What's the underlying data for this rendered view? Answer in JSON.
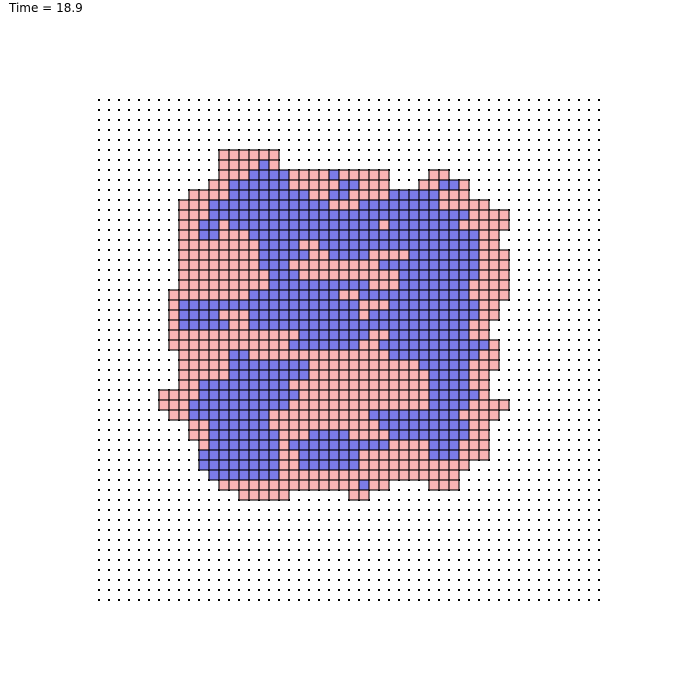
{
  "header": {
    "time_label": "Time = ",
    "time_value": "18.9"
  },
  "lattice": {
    "cols": 51,
    "rows": 51,
    "colors": {
      "blue": "#7b7be8",
      "pink": "#fab4b4",
      "grid_dot": "#000000",
      "cell_border": "#000000"
    },
    "row_runs": [
      [
        6,
        [
          [
            13,
            19,
            "P"
          ]
        ]
      ],
      [
        7,
        [
          [
            13,
            17,
            "P"
          ],
          [
            17,
            18,
            "B"
          ],
          [
            18,
            19,
            "P"
          ]
        ]
      ],
      [
        8,
        [
          [
            13,
            16,
            "P"
          ],
          [
            16,
            20,
            "B"
          ],
          [
            20,
            24,
            "P"
          ],
          [
            24,
            25,
            "B"
          ],
          [
            25,
            30,
            "P"
          ],
          [
            34,
            36,
            "P"
          ]
        ]
      ],
      [
        9,
        [
          [
            12,
            14,
            "P"
          ],
          [
            14,
            20,
            "B"
          ],
          [
            20,
            25,
            "P"
          ],
          [
            25,
            27,
            "B"
          ],
          [
            27,
            30,
            "P"
          ],
          [
            33,
            35,
            "P"
          ],
          [
            35,
            37,
            "B"
          ],
          [
            37,
            38,
            "P"
          ]
        ]
      ],
      [
        10,
        [
          [
            10,
            14,
            "P"
          ],
          [
            14,
            22,
            "B"
          ],
          [
            22,
            24,
            "P"
          ],
          [
            24,
            26,
            "B"
          ],
          [
            26,
            30,
            "P"
          ],
          [
            30,
            35,
            "B"
          ],
          [
            35,
            38,
            "P"
          ]
        ]
      ],
      [
        11,
        [
          [
            9,
            12,
            "P"
          ],
          [
            12,
            24,
            "B"
          ],
          [
            24,
            27,
            "P"
          ],
          [
            27,
            35,
            "B"
          ],
          [
            35,
            38,
            "P"
          ],
          [
            38,
            40,
            "P"
          ]
        ]
      ],
      [
        12,
        [
          [
            9,
            12,
            "P"
          ],
          [
            12,
            22,
            "B"
          ],
          [
            22,
            26,
            "B"
          ],
          [
            26,
            28,
            "B"
          ],
          [
            28,
            34,
            "B"
          ],
          [
            34,
            38,
            "B"
          ],
          [
            38,
            40,
            "P"
          ],
          [
            40,
            42,
            "P"
          ]
        ]
      ],
      [
        13,
        [
          [
            9,
            11,
            "P"
          ],
          [
            11,
            13,
            "B"
          ],
          [
            13,
            14,
            "P"
          ],
          [
            14,
            29,
            "B"
          ],
          [
            29,
            30,
            "P"
          ],
          [
            30,
            37,
            "B"
          ],
          [
            37,
            42,
            "P"
          ]
        ]
      ],
      [
        14,
        [
          [
            9,
            11,
            "P"
          ],
          [
            11,
            13,
            "B"
          ],
          [
            13,
            16,
            "P"
          ],
          [
            16,
            34,
            "B"
          ],
          [
            34,
            39,
            "B"
          ],
          [
            39,
            41,
            "P"
          ]
        ]
      ],
      [
        15,
        [
          [
            9,
            11,
            "P"
          ],
          [
            11,
            17,
            "P"
          ],
          [
            17,
            21,
            "B"
          ],
          [
            21,
            23,
            "P"
          ],
          [
            23,
            28,
            "B"
          ],
          [
            28,
            35,
            "B"
          ],
          [
            35,
            39,
            "B"
          ],
          [
            39,
            41,
            "P"
          ]
        ]
      ],
      [
        16,
        [
          [
            9,
            13,
            "P"
          ],
          [
            13,
            17,
            "P"
          ],
          [
            17,
            22,
            "B"
          ],
          [
            22,
            24,
            "P"
          ],
          [
            24,
            28,
            "B"
          ],
          [
            28,
            32,
            "P"
          ],
          [
            32,
            39,
            "B"
          ],
          [
            39,
            42,
            "P"
          ]
        ]
      ],
      [
        17,
        [
          [
            9,
            13,
            "P"
          ],
          [
            13,
            17,
            "P"
          ],
          [
            17,
            20,
            "B"
          ],
          [
            20,
            29,
            "P"
          ],
          [
            29,
            31,
            "B"
          ],
          [
            31,
            39,
            "B"
          ],
          [
            39,
            42,
            "P"
          ]
        ]
      ],
      [
        18,
        [
          [
            9,
            13,
            "P"
          ],
          [
            13,
            18,
            "P"
          ],
          [
            18,
            21,
            "B"
          ],
          [
            21,
            26,
            "P"
          ],
          [
            26,
            29,
            "P"
          ],
          [
            29,
            31,
            "P"
          ],
          [
            31,
            39,
            "B"
          ],
          [
            39,
            42,
            "P"
          ]
        ]
      ],
      [
        19,
        [
          [
            9,
            13,
            "P"
          ],
          [
            13,
            18,
            "P"
          ],
          [
            18,
            20,
            "B"
          ],
          [
            20,
            28,
            "B"
          ],
          [
            28,
            31,
            "P"
          ],
          [
            31,
            38,
            "B"
          ],
          [
            38,
            42,
            "P"
          ]
        ]
      ],
      [
        20,
        [
          [
            8,
            11,
            "P"
          ],
          [
            11,
            16,
            "P"
          ],
          [
            16,
            25,
            "B"
          ],
          [
            25,
            27,
            "P"
          ],
          [
            27,
            36,
            "B"
          ],
          [
            36,
            38,
            "B"
          ],
          [
            38,
            42,
            "P"
          ]
        ]
      ],
      [
        21,
        [
          [
            8,
            9,
            "P"
          ],
          [
            9,
            16,
            "B"
          ],
          [
            16,
            27,
            "B"
          ],
          [
            27,
            30,
            "P"
          ],
          [
            30,
            36,
            "B"
          ],
          [
            36,
            39,
            "B"
          ],
          [
            39,
            41,
            "P"
          ]
        ]
      ],
      [
        22,
        [
          [
            8,
            9,
            "P"
          ],
          [
            9,
            13,
            "B"
          ],
          [
            13,
            16,
            "P"
          ],
          [
            16,
            24,
            "B"
          ],
          [
            24,
            27,
            "B"
          ],
          [
            27,
            28,
            "P"
          ],
          [
            28,
            39,
            "B"
          ],
          [
            39,
            41,
            "P"
          ]
        ]
      ],
      [
        23,
        [
          [
            8,
            9,
            "P"
          ],
          [
            9,
            14,
            "B"
          ],
          [
            14,
            16,
            "P"
          ],
          [
            16,
            20,
            "B"
          ],
          [
            20,
            27,
            "B"
          ],
          [
            27,
            38,
            "B"
          ],
          [
            38,
            40,
            "P"
          ]
        ]
      ],
      [
        24,
        [
          [
            8,
            14,
            "P"
          ],
          [
            14,
            16,
            "P"
          ],
          [
            16,
            21,
            "P"
          ],
          [
            21,
            28,
            "B"
          ],
          [
            28,
            30,
            "P"
          ],
          [
            30,
            38,
            "B"
          ],
          [
            38,
            40,
            "P"
          ]
        ]
      ],
      [
        25,
        [
          [
            8,
            14,
            "P"
          ],
          [
            14,
            16,
            "P"
          ],
          [
            16,
            20,
            "P"
          ],
          [
            20,
            27,
            "B"
          ],
          [
            27,
            29,
            "P"
          ],
          [
            29,
            35,
            "B"
          ],
          [
            35,
            40,
            "B"
          ],
          [
            40,
            41,
            "P"
          ]
        ]
      ],
      [
        26,
        [
          [
            9,
            14,
            "P"
          ],
          [
            14,
            16,
            "B"
          ],
          [
            16,
            21,
            "P"
          ],
          [
            21,
            30,
            "P"
          ],
          [
            30,
            36,
            "B"
          ],
          [
            36,
            39,
            "B"
          ],
          [
            39,
            41,
            "P"
          ]
        ]
      ],
      [
        27,
        [
          [
            9,
            13,
            "P"
          ],
          [
            13,
            14,
            "P"
          ],
          [
            14,
            17,
            "B"
          ],
          [
            17,
            22,
            "B"
          ],
          [
            22,
            33,
            "P"
          ],
          [
            33,
            38,
            "B"
          ],
          [
            38,
            41,
            "P"
          ]
        ]
      ],
      [
        28,
        [
          [
            9,
            14,
            "P"
          ],
          [
            14,
            22,
            "B"
          ],
          [
            22,
            34,
            "P"
          ],
          [
            34,
            38,
            "B"
          ],
          [
            38,
            40,
            "P"
          ]
        ]
      ],
      [
        29,
        [
          [
            9,
            11,
            "P"
          ],
          [
            11,
            20,
            "B"
          ],
          [
            20,
            22,
            "P"
          ],
          [
            22,
            34,
            "P"
          ],
          [
            34,
            38,
            "B"
          ],
          [
            38,
            40,
            "P"
          ]
        ]
      ],
      [
        30,
        [
          [
            7,
            9,
            "P"
          ],
          [
            9,
            11,
            "P"
          ],
          [
            11,
            21,
            "B"
          ],
          [
            21,
            34,
            "P"
          ],
          [
            34,
            39,
            "B"
          ],
          [
            39,
            40,
            "P"
          ]
        ]
      ],
      [
        31,
        [
          [
            7,
            10,
            "P"
          ],
          [
            10,
            20,
            "B"
          ],
          [
            20,
            34,
            "P"
          ],
          [
            34,
            38,
            "B"
          ],
          [
            38,
            42,
            "P"
          ]
        ]
      ],
      [
        32,
        [
          [
            8,
            10,
            "P"
          ],
          [
            10,
            14,
            "B"
          ],
          [
            14,
            18,
            "B"
          ],
          [
            18,
            22,
            "P"
          ],
          [
            22,
            28,
            "P"
          ],
          [
            28,
            37,
            "B"
          ],
          [
            37,
            41,
            "P"
          ]
        ]
      ],
      [
        33,
        [
          [
            10,
            12,
            "P"
          ],
          [
            12,
            18,
            "B"
          ],
          [
            18,
            20,
            "P"
          ],
          [
            20,
            28,
            "P"
          ],
          [
            28,
            29,
            "P"
          ],
          [
            29,
            38,
            "B"
          ],
          [
            38,
            40,
            "P"
          ]
        ]
      ],
      [
        34,
        [
          [
            10,
            12,
            "P"
          ],
          [
            12,
            19,
            "B"
          ],
          [
            19,
            22,
            "P"
          ],
          [
            22,
            26,
            "B"
          ],
          [
            26,
            30,
            "P"
          ],
          [
            30,
            38,
            "B"
          ],
          [
            38,
            40,
            "P"
          ]
        ]
      ],
      [
        35,
        [
          [
            11,
            12,
            "P"
          ],
          [
            12,
            19,
            "B"
          ],
          [
            19,
            20,
            "P"
          ],
          [
            20,
            30,
            "B"
          ],
          [
            30,
            34,
            "P"
          ],
          [
            34,
            37,
            "B"
          ],
          [
            37,
            40,
            "P"
          ]
        ]
      ],
      [
        36,
        [
          [
            11,
            19,
            "B"
          ],
          [
            19,
            21,
            "P"
          ],
          [
            21,
            27,
            "B"
          ],
          [
            27,
            29,
            "P"
          ],
          [
            29,
            34,
            "P"
          ],
          [
            34,
            37,
            "B"
          ],
          [
            37,
            40,
            "P"
          ]
        ]
      ],
      [
        37,
        [
          [
            11,
            19,
            "B"
          ],
          [
            19,
            21,
            "P"
          ],
          [
            21,
            27,
            "B"
          ],
          [
            27,
            30,
            "P"
          ],
          [
            30,
            33,
            "P"
          ],
          [
            33,
            37,
            "P"
          ],
          [
            37,
            38,
            "P"
          ]
        ]
      ],
      [
        38,
        [
          [
            12,
            19,
            "B"
          ],
          [
            19,
            31,
            "P"
          ],
          [
            31,
            33,
            "P"
          ],
          [
            33,
            37,
            "P"
          ]
        ]
      ],
      [
        39,
        [
          [
            13,
            15,
            "P"
          ],
          [
            15,
            20,
            "P"
          ],
          [
            20,
            27,
            "P"
          ],
          [
            27,
            28,
            "B"
          ],
          [
            28,
            30,
            "P"
          ],
          [
            34,
            37,
            "P"
          ]
        ]
      ],
      [
        40,
        [
          [
            15,
            20,
            "P"
          ],
          [
            26,
            28,
            "P"
          ]
        ]
      ]
    ]
  }
}
